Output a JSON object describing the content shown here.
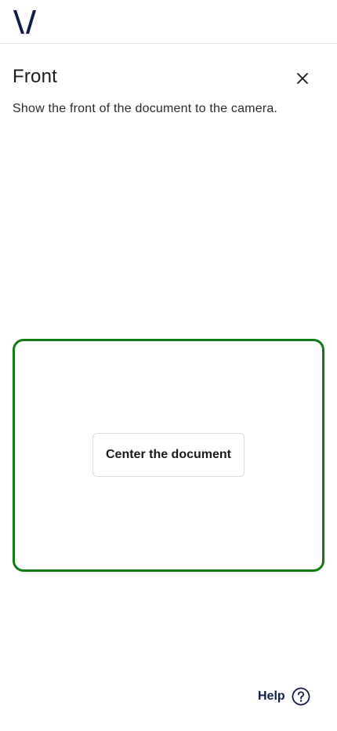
{
  "header": {
    "logo_icon": "veriff-v-logo"
  },
  "step": {
    "title": "Front",
    "instruction": "Show the front of the document to the camera.",
    "close_icon": "close-icon"
  },
  "camera": {
    "frame_color": "#117a12",
    "hint": "Center the document"
  },
  "footer": {
    "help_label": "Help",
    "help_icon": "question-circle-icon"
  },
  "colors": {
    "brand_navy": "#0e1d45",
    "frame_green": "#117a12"
  }
}
